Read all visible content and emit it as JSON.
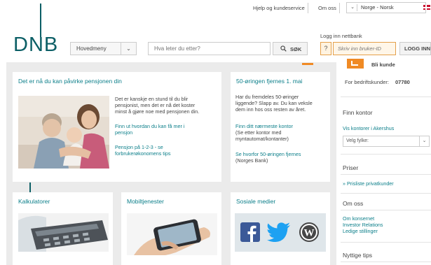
{
  "topbar": {
    "help_link": "Hjelp og kundeservice",
    "about_link": "Om oss",
    "language_select": "Norge - Norsk"
  },
  "header": {
    "logo_text": "DNB",
    "menu_label": "Hovedmeny",
    "search_placeholder": "Hva leter du etter?",
    "search_button": "SØK",
    "login_label": "Logg inn nettbank",
    "login_help": "?",
    "login_placeholder": "Skriv inn bruker-ID",
    "login_button": "LOGG INN"
  },
  "colors": {
    "brand_teal": "#0c5f66",
    "link_teal": "#0c7f8a",
    "accent_orange": "#f08a24",
    "content_bg": "#ebebeb"
  },
  "cards": {
    "pension": {
      "title": "Det er nå du kan påvirke pensjonen din",
      "paragraph": [
        "Det er kanskje en stund til du blir",
        "pensjonist, men det er nå det koster",
        "minst å gjøre noe med pensjonen din."
      ],
      "link1": [
        "Finn ut hvordan du kan få mer i",
        "pensjon"
      ],
      "link2": [
        "Pensjon på 1-2-3 - se",
        "forbrukerøkonomens tips"
      ]
    },
    "coin": {
      "title": "50-øringen fjernes 1. mai",
      "paragraph": [
        "Har du fremdeles 50-øringer",
        "liggende? Slapp av. Du kan veksle",
        "dem inn hos oss resten av året."
      ],
      "link1": "Finn ditt nærmeste kontor",
      "link1_sub": [
        "(Se etter kontor med",
        "myntautomat/kontanter)"
      ],
      "link2": "Se hvorfor 50-øringen fjernes",
      "link2_sub": "(Norges Bank)"
    },
    "calculators": {
      "title": "Kalkulatorer"
    },
    "mobile": {
      "title": "Mobiltjenester"
    },
    "social": {
      "title": "Sosiale medier"
    }
  },
  "sidebar": {
    "become_customer": "Bli kunde",
    "business_customers": "For bedriftskunder:",
    "business_phone": "07780",
    "find_office_heading": "Finn kontor",
    "offices_link": "Vis kontorer i Akershus",
    "county_select": "Velg fylke:",
    "prices_heading": "Priser",
    "price_list_link": "» Prisliste privatkunder",
    "about_heading": "Om oss",
    "about_links": [
      "Om konsernet",
      "Investor Relations",
      "Ledige stillinger"
    ],
    "useful_tips_heading": "Nyttige tips"
  }
}
